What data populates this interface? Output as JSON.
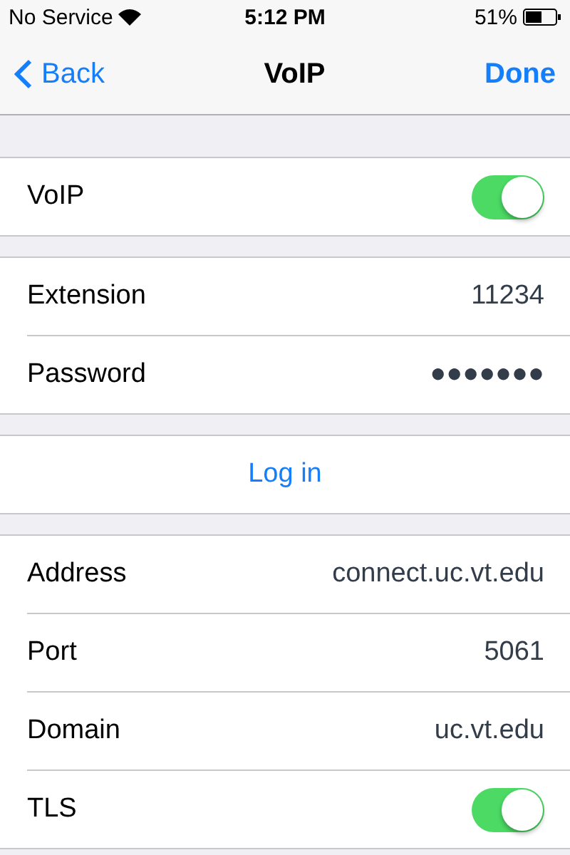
{
  "status_bar": {
    "carrier": "No Service",
    "time": "5:12 PM",
    "battery": "51%"
  },
  "nav": {
    "back": "Back",
    "title": "VoIP",
    "done": "Done"
  },
  "sections": [
    {
      "rows": [
        {
          "kind": "toggle",
          "label": "VoIP",
          "on": true
        }
      ]
    },
    {
      "rows": [
        {
          "kind": "value",
          "label": "Extension",
          "value": "11234"
        },
        {
          "kind": "value",
          "label": "Password",
          "value": "●●●●●●●"
        }
      ]
    },
    {
      "rows": [
        {
          "kind": "action",
          "label": "Log in"
        }
      ]
    },
    {
      "rows": [
        {
          "kind": "value",
          "label": "Address",
          "value": "connect.uc.vt.edu"
        },
        {
          "kind": "value",
          "label": "Port",
          "value": "5061"
        },
        {
          "kind": "value",
          "label": "Domain",
          "value": "uc.vt.edu"
        },
        {
          "kind": "toggle",
          "label": "TLS",
          "on": true
        }
      ]
    }
  ]
}
